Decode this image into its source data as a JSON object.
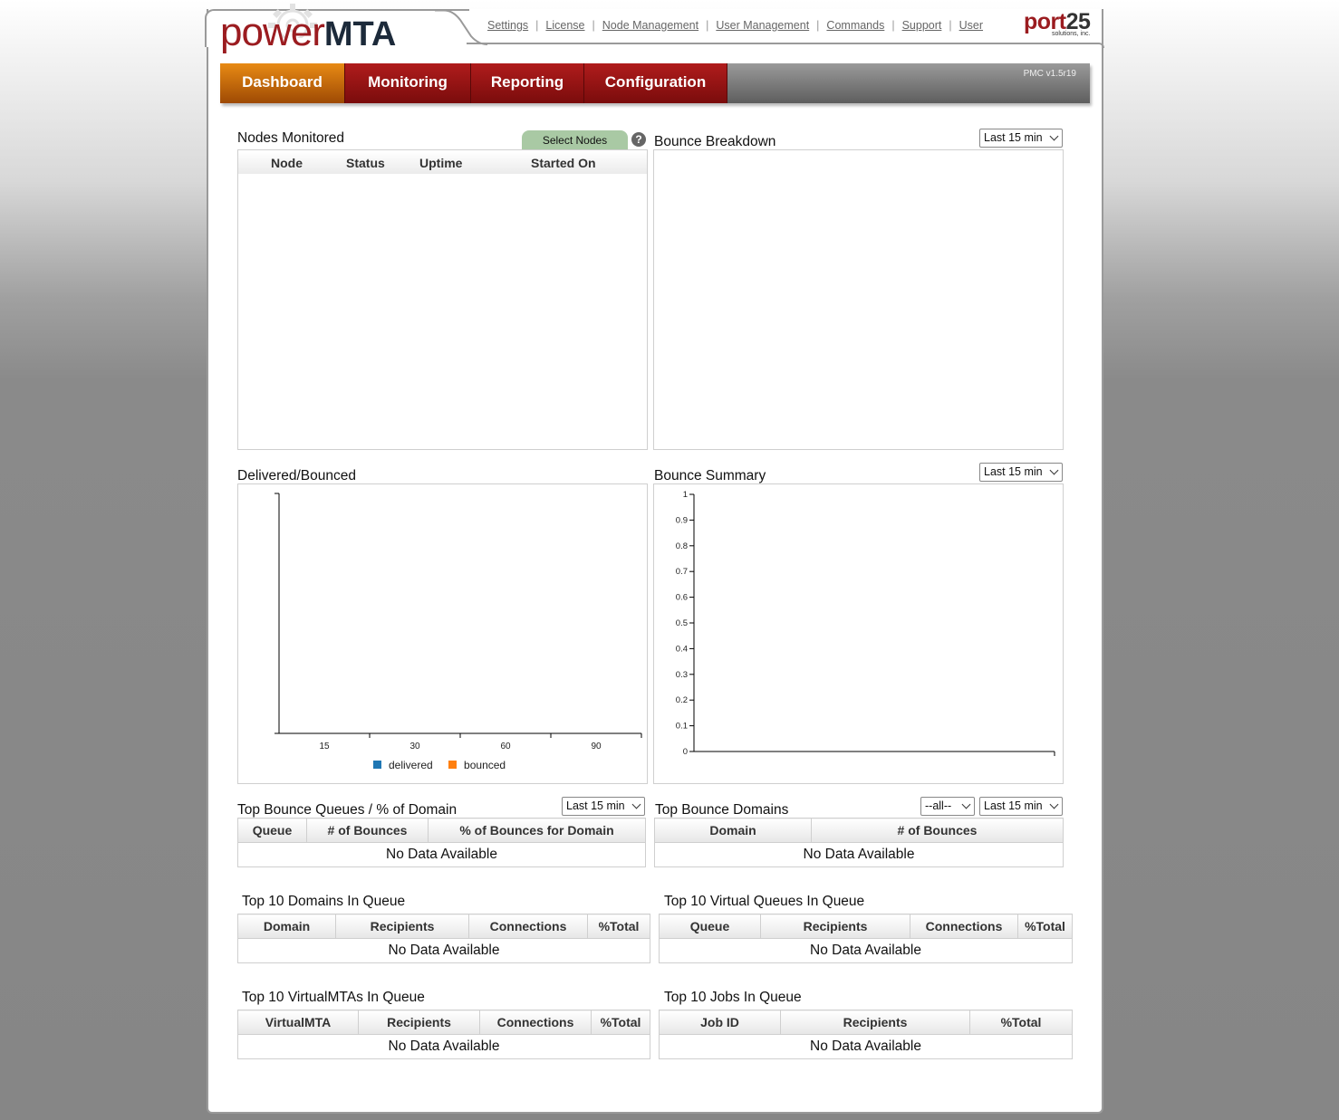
{
  "brand": {
    "power": "power",
    "mta": "MTA",
    "port25": "port",
    "port25_num": "25",
    "port25_sub": "solutions, inc."
  },
  "top_links": [
    "Settings",
    "License",
    "Node Management",
    "User Management",
    "Commands",
    "Support",
    "User"
  ],
  "nav": {
    "tabs": [
      {
        "label": "Dashboard",
        "active": true
      },
      {
        "label": "Monitoring",
        "active": false
      },
      {
        "label": "Reporting",
        "active": false
      },
      {
        "label": "Configuration",
        "active": false
      }
    ],
    "version": "PMC v1.5r19"
  },
  "colors": {
    "brand_red": "#9b1c20",
    "tab_active": "#e88a14",
    "delivered": "#1f77b4",
    "bounced": "#ff7f0e"
  },
  "nodes_monitored": {
    "title": "Nodes Monitored",
    "select_button": "Select Nodes",
    "help": "?",
    "columns": [
      "Node",
      "Status",
      "Uptime",
      "Started On"
    ]
  },
  "bounce_breakdown": {
    "title": "Bounce Breakdown",
    "range": "Last 15 min"
  },
  "delivered_bounced": {
    "title": "Delivered/Bounced",
    "legend": [
      "delivered",
      "bounced"
    ]
  },
  "bounce_summary": {
    "title": "Bounce Summary",
    "range": "Last 15 min"
  },
  "chart_data": [
    {
      "type": "bar",
      "title": "Delivered/Bounced",
      "categories": [
        "15",
        "30",
        "60",
        "90"
      ],
      "series": [
        {
          "name": "delivered",
          "values": []
        },
        {
          "name": "bounced",
          "values": []
        }
      ],
      "legend": "bottom"
    },
    {
      "type": "line",
      "title": "Bounce Summary",
      "y_ticks": [
        "0",
        "0.1",
        "0.2",
        "0.3",
        "0.4",
        "0.5",
        "0.6",
        "0.7",
        "0.8",
        "0.9",
        "1"
      ],
      "ylim": [
        0,
        1
      ],
      "series": []
    }
  ],
  "top_bounce_queues": {
    "title": "Top Bounce Queues / % of Domain",
    "range": "Last 15 min",
    "columns": [
      "Queue",
      "# of Bounces",
      "% of Bounces for Domain"
    ],
    "empty": "No Data Available"
  },
  "top_bounce_domains": {
    "title": "Top Bounce Domains",
    "filter": "--all--",
    "range": "Last 15 min",
    "columns": [
      "Domain",
      "# of Bounces"
    ],
    "empty": "No Data Available"
  },
  "top_domains_queue": {
    "title": "Top 10 Domains In Queue",
    "columns": [
      "Domain",
      "Recipients",
      "Connections",
      "%Total"
    ],
    "empty": "No Data Available"
  },
  "top_vqueues_queue": {
    "title": "Top 10 Virtual Queues In Queue",
    "columns": [
      "Queue",
      "Recipients",
      "Connections",
      "%Total"
    ],
    "empty": "No Data Available"
  },
  "top_vmtas_queue": {
    "title": "Top 10 VirtualMTAs In Queue",
    "columns": [
      "VirtualMTA",
      "Recipients",
      "Connections",
      "%Total"
    ],
    "empty": "No Data Available"
  },
  "top_jobs_queue": {
    "title": "Top 10 Jobs In Queue",
    "columns": [
      "Job ID",
      "Recipients",
      "%Total"
    ],
    "empty": "No Data Available"
  }
}
